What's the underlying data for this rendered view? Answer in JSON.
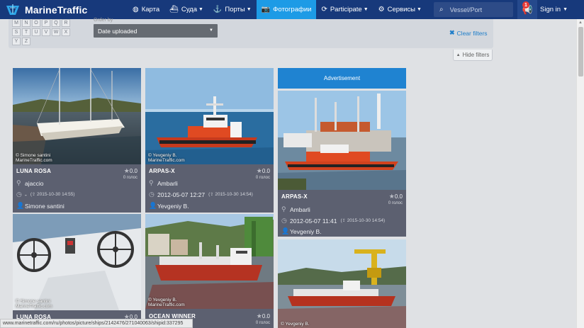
{
  "brand": {
    "name": "MarineTraffic"
  },
  "nav": {
    "items": [
      {
        "label": "Карта",
        "icon": "globe-icon",
        "glyph": "◍",
        "caret": false,
        "active": false
      },
      {
        "label": "Суда",
        "icon": "ship-icon",
        "glyph": "⛴",
        "caret": true,
        "active": false
      },
      {
        "label": "Порты",
        "icon": "anchor-icon",
        "glyph": "⚓",
        "caret": true,
        "active": false
      },
      {
        "label": "Фотографии",
        "icon": "camera-icon",
        "glyph": "📷",
        "caret": false,
        "active": true
      },
      {
        "label": "Participate",
        "icon": "refresh-icon",
        "glyph": "⟳",
        "caret": true,
        "active": false
      },
      {
        "label": "Сервисы",
        "icon": "gear-icon",
        "glyph": "⚙",
        "caret": true,
        "active": false
      }
    ],
    "search_placeholder": "Vessel/Port",
    "notifications": "1",
    "signin_label": "Sign in"
  },
  "filters": {
    "letters": [
      [
        "M",
        "N",
        "O",
        "P",
        "Q",
        "R"
      ],
      [
        "S",
        "T",
        "U",
        "V",
        "W",
        "X"
      ],
      [
        "Y",
        "Z"
      ]
    ],
    "order_by_label": "Order by",
    "order_by_value": "Date uploaded",
    "clear_label": "Clear filters",
    "hide_label": "Hide filters"
  },
  "advertisement_label": "Advertisement",
  "photos": [
    {
      "name": "LUNA ROSA",
      "votes": "0.0",
      "votes_label": "0 голос",
      "location": "ajaccio",
      "date": "-",
      "uploaded": "2015-10-30 14:55",
      "author": "Simone santini",
      "credit1": "© Simone santini",
      "credit2": "MarineTraffic.com"
    },
    {
      "name": "ARPAS-X",
      "votes": "0.0",
      "votes_label": "0 голос",
      "location": "Ambarli",
      "date": "2012-05-07 12:27",
      "uploaded": "2015-10-30 14:54",
      "author": "Yevgeniy B.",
      "credit1": "© Yevgeniy B.",
      "credit2": "MarineTraffic.com"
    },
    {
      "name": "ARPAS-X",
      "votes": "0.0",
      "votes_label": "0 голос",
      "location": "Ambarli",
      "date": "2012-05-07 11:41",
      "uploaded": "2015-10-30 14:54",
      "author": "Yevgeniy B.",
      "credit1": "",
      "credit2": ""
    },
    {
      "name": "LUNA ROSA",
      "votes": "0.0",
      "votes_label": "",
      "credit1": "© Simone santini",
      "credit2": "MarineTraffic.com"
    },
    {
      "name": "OCEAN WINNER",
      "votes": "0.0",
      "votes_label": "0 голос",
      "credit1": "© Yevgeniy B.",
      "credit2": "MarineTraffic.com"
    },
    {
      "name": "",
      "votes": "",
      "votes_label": "",
      "credit1": "© Yevgeniy B.",
      "credit2": ""
    }
  ],
  "status_url": "www.marinetraffic.com/ru/photos/picture/ships/2142476/271040063/shipid:337295"
}
